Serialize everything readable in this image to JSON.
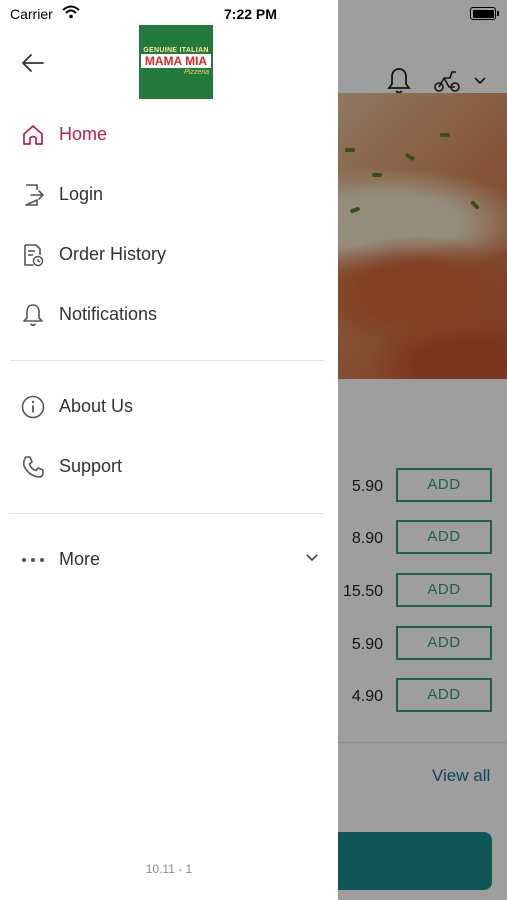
{
  "status_bar": {
    "carrier": "Carrier",
    "time": "7:22 PM"
  },
  "drawer": {
    "logo": {
      "top_text": "GENUINE ITALIAN",
      "main_text": "MAMA MIA",
      "sub_text": "Pizzeria"
    },
    "menu": [
      {
        "label": "Home",
        "icon": "home-icon",
        "active": true
      },
      {
        "label": "Login",
        "icon": "login-icon"
      },
      {
        "label": "Order History",
        "icon": "order-history-icon"
      },
      {
        "label": "Notifications",
        "icon": "bell-icon"
      },
      {
        "label": "About Us",
        "icon": "info-icon"
      },
      {
        "label": "Support",
        "icon": "phone-icon"
      },
      {
        "label": "More",
        "icon": "more-dots-icon"
      }
    ],
    "version": "10.11 - 1",
    "accent_color": "#b5214a"
  },
  "background": {
    "items": [
      {
        "price": "5.90",
        "button": "ADD"
      },
      {
        "price": "8.90",
        "button": "ADD"
      },
      {
        "price": "15.50",
        "button": "ADD"
      },
      {
        "price": "5.90",
        "button": "ADD"
      },
      {
        "price": "4.90",
        "button": "ADD"
      }
    ],
    "view_all": "View all",
    "accent_color": "#2f9d78"
  }
}
